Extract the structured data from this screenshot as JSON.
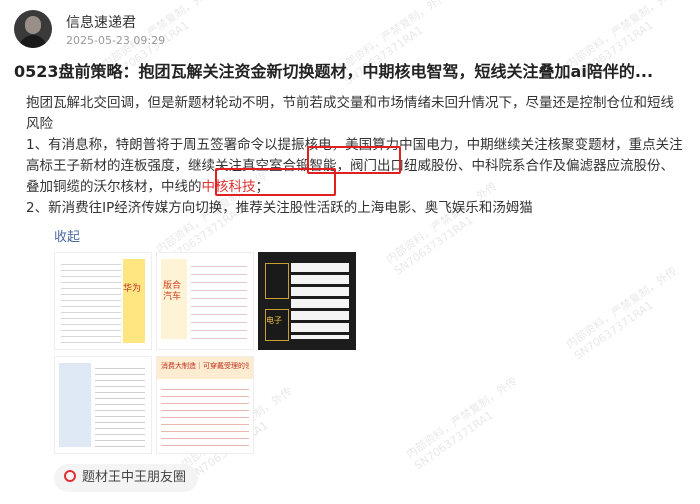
{
  "author": {
    "name": "信息速递君",
    "time": "2025-05-23 09:29"
  },
  "post": {
    "title": "0523盘前策略：抱团瓦解关注资金新切换题材，中期核电智驾，短线关注叠加ai陪伴的...",
    "para1": "抱团瓦解北交回调，但是新题材轮动不明，节前若成交量和市场情绪未回升情况下，尽量还是控制仓位和短线风险",
    "para2_a": "1、有消息称，特朗普将于周五签署命令以提振核电，美国算力中国电力，中期继续关注核聚变题材，重点关注高标王子新材的连板强度，继续关注真空室合锻智能，阀门出口纽威股份、中科院系合作及偏滤器应流股份、叠加铜缆的沃尔核材，",
    "para2_b": "中线的",
    "para2_c": "中核科技",
    "para2_d": "；",
    "para3": "2、新消费往IP经济传媒方向切换，推荐关注股性活跃的上海电影、奥飞娱乐和汤姆猫",
    "collapse_label": "收起"
  },
  "images": {
    "t1": {
      "label": "华为"
    },
    "t2": {
      "label": "版合汽车"
    },
    "t3": {
      "label": "电子"
    },
    "t5": {
      "header": "消费大制造｜可穿戴受理的领域"
    }
  },
  "topic_tag": {
    "label": "题材王中王朋友圈",
    "icon": "topic-icon"
  },
  "watermark": {
    "text": "内部资料，严禁复制，外传",
    "code": "SN70637371RA1"
  },
  "colors": {
    "highlight_red": "#e03030",
    "link_blue": "#4a6aa0"
  }
}
